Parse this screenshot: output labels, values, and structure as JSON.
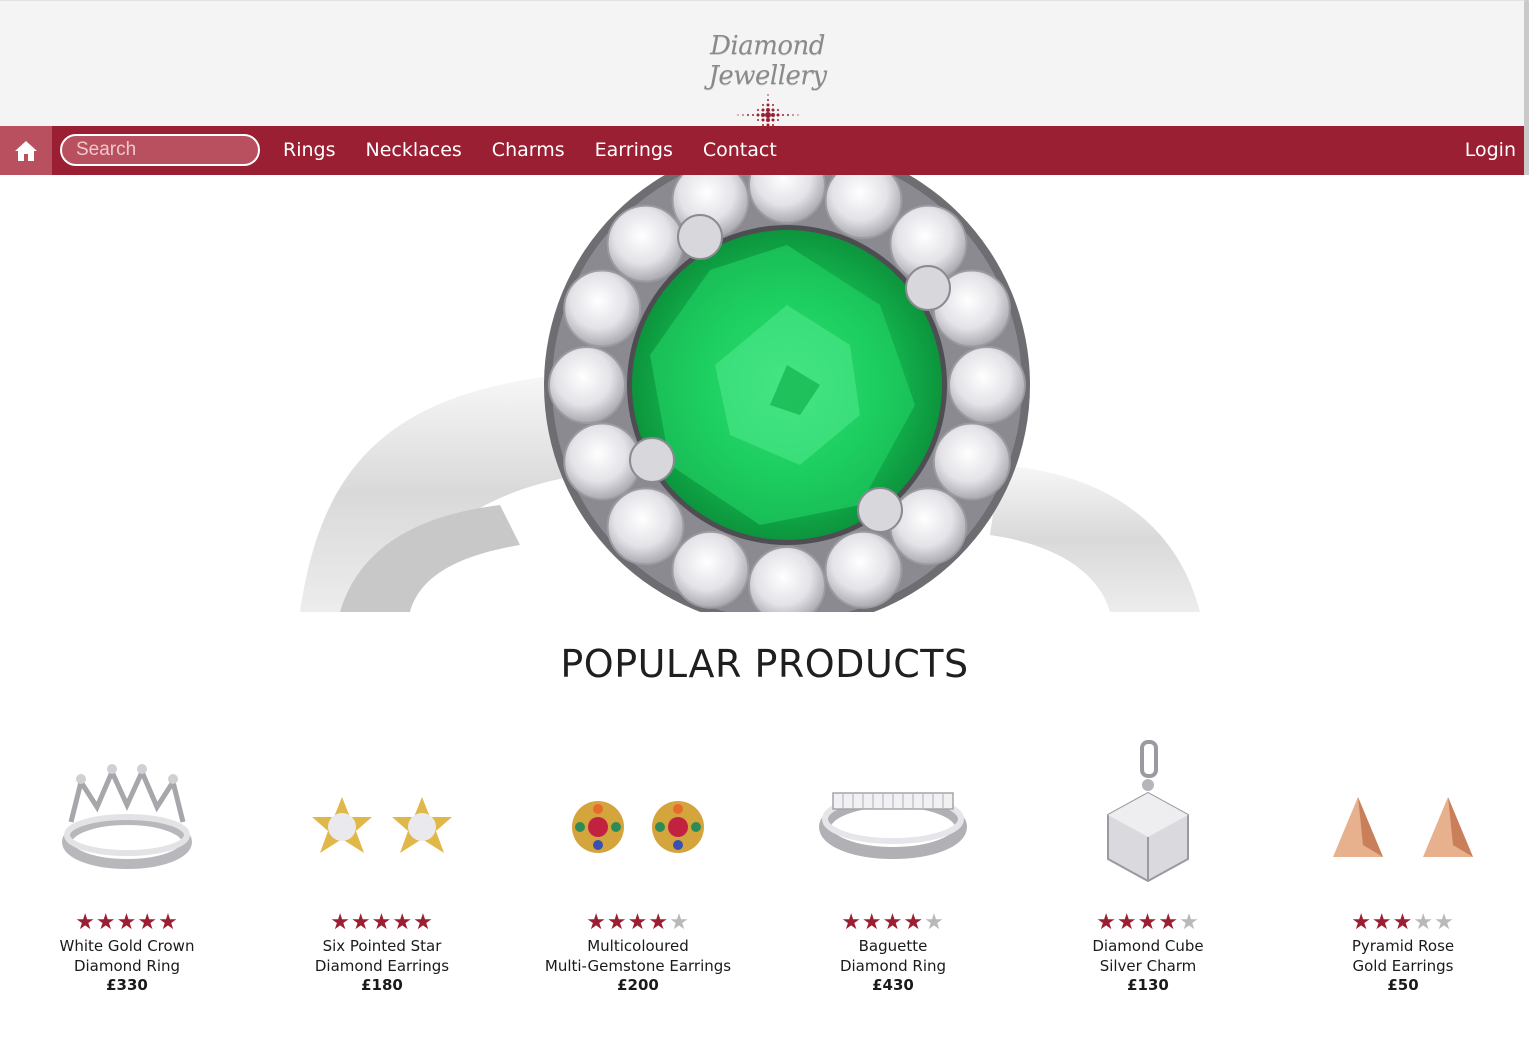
{
  "header": {
    "logo_text": "Diamond Jewellery",
    "logo_icon": "sparkle-diamond-icon"
  },
  "nav": {
    "home_icon": "home-icon",
    "search_placeholder": "Search",
    "links": [
      "Rings",
      "Necklaces",
      "Charms",
      "Earrings",
      "Contact"
    ],
    "login_label": "Login"
  },
  "hero": {
    "image": "emerald-halo-ring"
  },
  "section": {
    "title": "POPULAR PRODUCTS"
  },
  "products": [
    {
      "name_line1": "White Gold Crown",
      "name_line2": "Diamond Ring",
      "price": "£330",
      "rating": 5,
      "image": "crown-ring"
    },
    {
      "name_line1": "Six Pointed Star",
      "name_line2": "Diamond Earrings",
      "price": "£180",
      "rating": 5,
      "image": "star-earrings"
    },
    {
      "name_line1": "Multicoloured",
      "name_line2": "Multi-Gemstone Earrings",
      "price": "£200",
      "rating": 4,
      "image": "gem-earrings"
    },
    {
      "name_line1": "Baguette",
      "name_line2": "Diamond Ring",
      "price": "£430",
      "rating": 4,
      "image": "baguette-ring"
    },
    {
      "name_line1": "Diamond Cube",
      "name_line2": "Silver Charm",
      "price": "£130",
      "rating": 4,
      "image": "cube-charm"
    },
    {
      "name_line1": "Pyramid Rose",
      "name_line2": "Gold Earrings",
      "price": "£50",
      "rating": 3,
      "image": "pyramid-earrings"
    }
  ],
  "colors": {
    "brand": "#9a1f33",
    "header_bg": "#f4f4f4",
    "star_off": "#b9b9b9"
  }
}
